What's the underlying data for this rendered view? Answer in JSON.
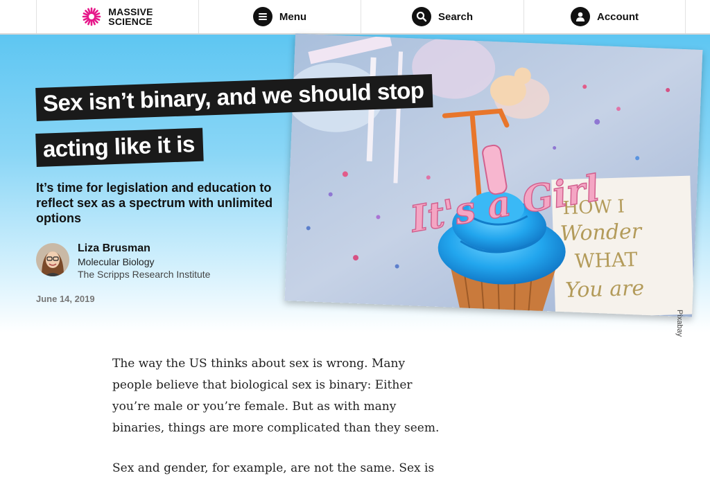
{
  "header": {
    "logo_line1": "MASSIVE",
    "logo_line2": "SCIENCE",
    "menu_label": "Menu",
    "search_label": "Search",
    "account_label": "Account"
  },
  "article": {
    "title_line1": "Sex isn’t binary, and we should stop",
    "title_line2": "acting like it is",
    "subtitle": "It’s time for legislation and education to reflect sex as a spectrum with unlimited options",
    "author": {
      "name": "Liza Brusman",
      "department": "Molecular Biology",
      "institution": "The Scripps Research Institute"
    },
    "date": "June 14, 2019",
    "image_credit": "Pixabay",
    "topper_text": "It's a Girl",
    "card_text": [
      "HOW I",
      "Wonder",
      "WHAT",
      "You are"
    ],
    "paragraphs": [
      "The way the US thinks about sex is wrong. Many people believe that biological sex is binary: Either you’re male or you’re female. But as with many binaries, things are more complicated than they seem.",
      "Sex and gender, for example, are not the same. Sex is"
    ]
  },
  "colors": {
    "hero_top": "#5ec6f2",
    "logo_accent": "#e6188a",
    "title_bg": "#1a1a1a"
  },
  "icons": [
    "massive-science-logo-icon",
    "menu-icon",
    "search-icon",
    "account-icon"
  ]
}
